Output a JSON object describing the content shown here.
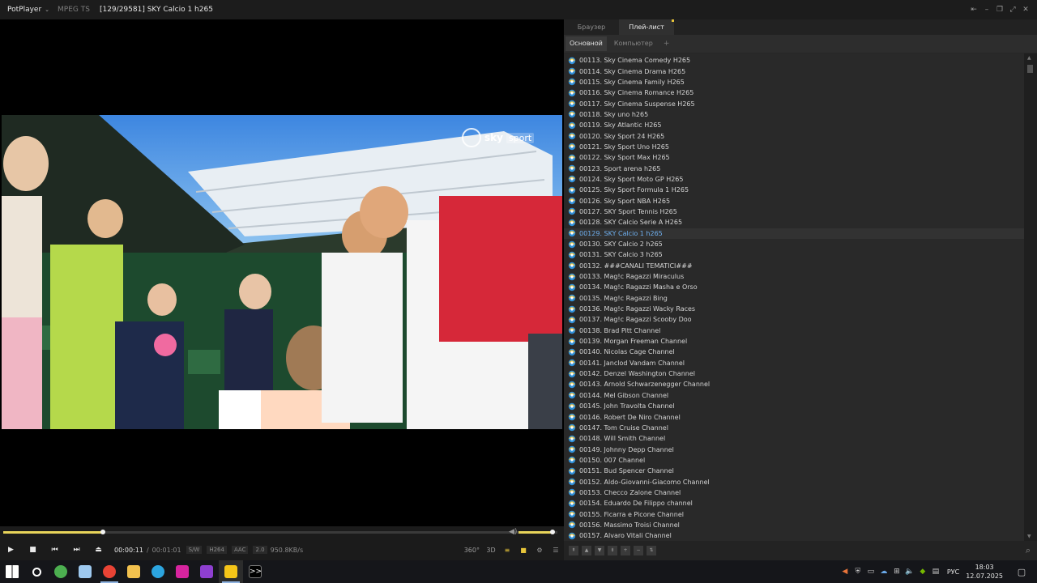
{
  "titlebar": {
    "app_name": "PotPlayer",
    "format": "MPEG TS",
    "title": "[129/29581] SKY Calcio 1 h265",
    "controls": [
      "pin-icon",
      "minimize-icon",
      "restore-icon",
      "fullscreen-icon",
      "close-icon"
    ]
  },
  "video": {
    "watermark_sky": "sky",
    "watermark_sport": "sport"
  },
  "playback": {
    "progress": 0.18,
    "volume": 0.95,
    "time_current": "00:00:11",
    "time_sep": "/",
    "time_total": "00:01:01",
    "badges": [
      "S/W",
      "H264",
      "AAC",
      "2.0"
    ],
    "bitrate": "950.8KB/s",
    "right_controls": [
      "360°",
      "3D",
      "≡",
      "■",
      "⚙",
      "☰"
    ]
  },
  "panel": {
    "tabs": [
      "Браузер",
      "Плей-лист"
    ],
    "active_tab": 1,
    "subtabs": [
      "Основной",
      "Компьютер"
    ],
    "subtab_add": "+",
    "active_subtab": 0,
    "current_index": 16,
    "items": [
      "00113. Sky Cinema Comedy H265",
      "00114. Sky Cinema Drama H265",
      "00115. Sky Cinema Family H265",
      "00116. Sky Cinema Romance H265",
      "00117. Sky Cinema Suspense H265",
      "00118. Sky uno h265",
      "00119. Sky Atlantic H265",
      "00120. Sky Sport 24 H265",
      "00121. Sky Sport Uno H265",
      "00122. Sky Sport Max H265",
      "00123. Sport arena h265",
      "00124. Sky Sport Moto GP H265",
      "00125. Sky Sport Formula 1 H265",
      "00126. Sky Sport NBA H265",
      "00127. SKY Sport Tennis H265",
      "00128. SKY Calcio Serie A  H265",
      "00129. SKY Calcio 1 h265",
      "00130. SKY Calcio 2 h265",
      "00131. SKY Calcio 3 h265",
      "00132. ###CANALI TEMATICI###",
      "00133. Mag!c Ragazzi Miraculus",
      "00134. Mag!c Ragazzi Masha e Orso",
      "00135. Mag!c Ragazzi Bing",
      "00136. Mag!c Ragazzi Wacky Races",
      "00137. Mag!c Ragazzi Scooby Doo",
      "00138. Brad Pitt Channel",
      "00139. Morgan Freeman Channel",
      "00140. Nicolas Cage Channel",
      "00141. Janclod Vandam Channel",
      "00142. Denzel Washington Channel",
      "00143. Arnold Schwarzenegger Channel",
      "00144. Mel Gibson Channel",
      "00145. John Travolta Channel",
      "00146. Robert De Niro Channel",
      "00147. Tom Cruise Channel",
      "00148. Will Smith Channel",
      "00149. Johnny Depp Channel",
      "00150. 007 Channel",
      "00151. Bud Spencer Channel",
      "00152. Aldo-Giovanni-Giacomo Channel",
      "00153. Checco Zalone Channel",
      "00154. Eduardo De Filippo channel",
      "00155. Ficarra e Picone Channel",
      "00156. Massimo Troisi Channel",
      "00157. Alvaro Vitali Channel"
    ],
    "footer_buttons": [
      "⇞",
      "▲",
      "▼",
      "⇟",
      "+",
      "−",
      "⇅"
    ]
  },
  "taskbar": {
    "apps": [
      {
        "name": "windows-start-icon",
        "color": "#ffffff"
      },
      {
        "name": "search-icon",
        "color": "#ffffff"
      },
      {
        "name": "torrent-icon",
        "color": "#4caf50"
      },
      {
        "name": "feather-app-icon",
        "color": "#9ec9f0"
      },
      {
        "name": "chrome-icon",
        "color": "#e94335"
      },
      {
        "name": "folder-icon",
        "color": "#f2c14e"
      },
      {
        "name": "telegram-icon",
        "color": "#2ca5e0"
      },
      {
        "name": "instagram-icon",
        "color": "#d6249f"
      },
      {
        "name": "download-icon",
        "color": "#8e3fd0"
      },
      {
        "name": "potplayer-icon",
        "color": "#f5c518"
      },
      {
        "name": "terminal-icon",
        "color": "#ffffff"
      }
    ],
    "language": "РУС",
    "time": "18:03",
    "date": "12.07.2025"
  },
  "colors": {
    "accent": "#e8d45a",
    "current_item": "#6fb0f0"
  }
}
